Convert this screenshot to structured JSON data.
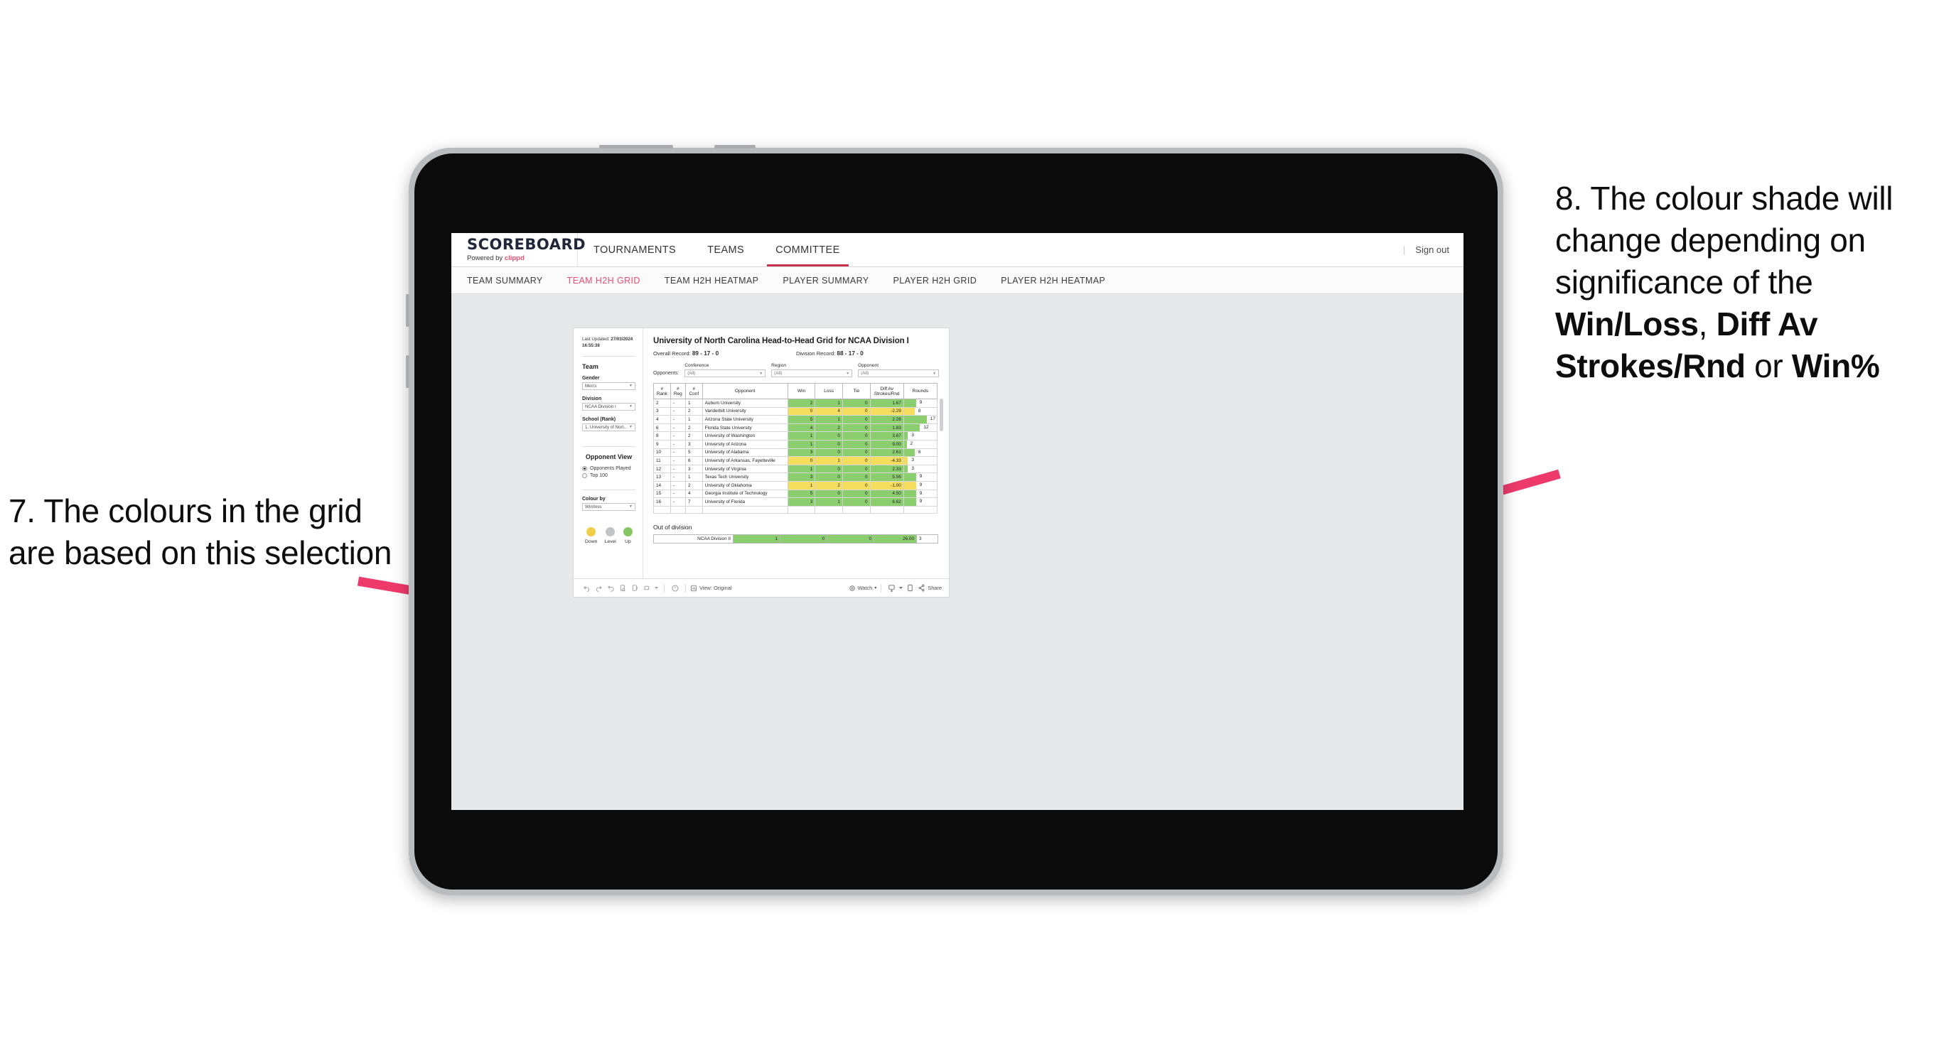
{
  "annotations": {
    "left": {
      "name": "annotation-7",
      "text": "7. The colours in the grid are based on this selection"
    },
    "right": {
      "name": "annotation-8",
      "prefix": "8. The colour shade will change depending on significance of the ",
      "bold1": "Win/Loss",
      "mid1": ", ",
      "bold2": "Diff Av Strokes/Rnd",
      "mid2": " or ",
      "bold3": "Win%"
    },
    "arrow_color": "#EE3A6B"
  },
  "app": {
    "logo": {
      "word": "SCOREBOARD",
      "powered_by": "Powered by ",
      "brand": "clippd"
    },
    "topnav": [
      {
        "label": "TOURNAMENTS",
        "active": false
      },
      {
        "label": "TEAMS",
        "active": false
      },
      {
        "label": "COMMITTEE",
        "active": true
      }
    ],
    "header_right": {
      "divider": "|",
      "sign_out": "Sign out"
    },
    "subnav": [
      {
        "label": "TEAM SUMMARY",
        "active": false
      },
      {
        "label": "TEAM H2H GRID",
        "active": true
      },
      {
        "label": "TEAM H2H HEATMAP",
        "active": false
      },
      {
        "label": "PLAYER SUMMARY",
        "active": false
      },
      {
        "label": "PLAYER H2H GRID",
        "active": false
      },
      {
        "label": "PLAYER H2H HEATMAP",
        "active": false
      }
    ],
    "accent_color": "#EF4C6F",
    "active_tab_underline": "#C8324F"
  },
  "sidebar": {
    "last_updated_label": "Last Updated: ",
    "last_updated_value": "27/03/2024 16:55:38",
    "team_heading": "Team",
    "fields": [
      {
        "label": "Gender",
        "value": "Men's"
      },
      {
        "label": "Division",
        "value": "NCAA Division I"
      },
      {
        "label": "School (Rank)",
        "value": "1. University of Nort..."
      }
    ],
    "opponent_view_heading": "Opponent View",
    "radios": [
      {
        "label": "Opponents Played",
        "selected": true
      },
      {
        "label": "Top 100",
        "selected": false
      }
    ],
    "colour_by": {
      "label": "Colour by",
      "value": "Win/loss"
    },
    "legend": [
      {
        "caption": "Down",
        "color": "#F2CE48"
      },
      {
        "caption": "Level",
        "color": "#C0C3C7"
      },
      {
        "caption": "Up",
        "color": "#86C763"
      }
    ]
  },
  "dashboard": {
    "title": "University of North Carolina Head-to-Head Grid for NCAA Division I",
    "overall_record_label": "Overall Record: ",
    "overall_record_value": "89 - 17 - 0",
    "division_record_label": "Division Record: ",
    "division_record_value": "88 - 17 - 0",
    "opponents_label": "Opponents:",
    "filters": [
      {
        "label": "Conference",
        "value": "(All)"
      },
      {
        "label": "Region",
        "value": "(All)"
      },
      {
        "label": "Opponent",
        "value": "(All)"
      }
    ],
    "out_of_division_title": "Out of division",
    "out_of_division_row": {
      "label": "NCAA Division II",
      "win": "1",
      "loss": "0",
      "tie": "0",
      "diff": "26.00",
      "rounds": "3"
    }
  },
  "chart_data": {
    "type": "table",
    "title": "University of North Carolina Head-to-Head Grid for NCAA Division I",
    "colour_by": "Win/loss",
    "colors": {
      "up": "#8BCE6E",
      "down": "#F5DD5E",
      "level": "#C0C3C7"
    },
    "columns": [
      "# Rank",
      "# Reg",
      "# Conf",
      "Opponent",
      "Win",
      "Loss",
      "Tie",
      "Diff Av Strokes/Rnd",
      "Rounds"
    ],
    "headers": [
      {
        "l1": "#",
        "l2": "Rank"
      },
      {
        "l1": "#",
        "l2": "Reg"
      },
      {
        "l1": "#",
        "l2": "Conf"
      },
      {
        "l1": "Opponent",
        "l2": ""
      },
      {
        "l1": "Win",
        "l2": ""
      },
      {
        "l1": "Loss",
        "l2": ""
      },
      {
        "l1": "Tie",
        "l2": ""
      },
      {
        "l1": "Diff Av",
        "l2": "Strokes/Rnd"
      },
      {
        "l1": "Rounds",
        "l2": ""
      }
    ],
    "rounds_max": 17,
    "rows": [
      {
        "rank": "2",
        "reg": "-",
        "conf": "1",
        "opponent": "Auburn University",
        "win": "2",
        "loss": "1",
        "tie": "0",
        "diff": "1.67",
        "rounds": "9",
        "state": "up"
      },
      {
        "rank": "3",
        "reg": "-",
        "conf": "2",
        "opponent": "Vanderbilt University",
        "win": "0",
        "loss": "4",
        "tie": "0",
        "diff": "-2.29",
        "rounds": "8",
        "state": "down"
      },
      {
        "rank": "4",
        "reg": "-",
        "conf": "1",
        "opponent": "Arizona State University",
        "win": "5",
        "loss": "1",
        "tie": "0",
        "diff": "2.28",
        "rounds": "17",
        "state": "up"
      },
      {
        "rank": "6",
        "reg": "-",
        "conf": "2",
        "opponent": "Florida State University",
        "win": "4",
        "loss": "2",
        "tie": "0",
        "diff": "1.83",
        "rounds": "12",
        "state": "up"
      },
      {
        "rank": "8",
        "reg": "-",
        "conf": "2",
        "opponent": "University of Washington",
        "win": "1",
        "loss": "0",
        "tie": "0",
        "diff": "3.67",
        "rounds": "3",
        "state": "up"
      },
      {
        "rank": "9",
        "reg": "-",
        "conf": "3",
        "opponent": "University of Arizona",
        "win": "1",
        "loss": "0",
        "tie": "0",
        "diff": "9.00",
        "rounds": "2",
        "state": "up"
      },
      {
        "rank": "10",
        "reg": "-",
        "conf": "5",
        "opponent": "University of Alabama",
        "win": "3",
        "loss": "0",
        "tie": "0",
        "diff": "2.61",
        "rounds": "8",
        "state": "up"
      },
      {
        "rank": "11",
        "reg": "-",
        "conf": "6",
        "opponent": "University of Arkansas, Fayetteville",
        "win": "0",
        "loss": "1",
        "tie": "0",
        "diff": "-4.33",
        "rounds": "3",
        "state": "down"
      },
      {
        "rank": "12",
        "reg": "-",
        "conf": "3",
        "opponent": "University of Virginia",
        "win": "1",
        "loss": "0",
        "tie": "0",
        "diff": "2.33",
        "rounds": "3",
        "state": "up"
      },
      {
        "rank": "13",
        "reg": "-",
        "conf": "1",
        "opponent": "Texas Tech University",
        "win": "3",
        "loss": "0",
        "tie": "0",
        "diff": "5.56",
        "rounds": "9",
        "state": "up"
      },
      {
        "rank": "14",
        "reg": "-",
        "conf": "2",
        "opponent": "University of Oklahoma",
        "win": "1",
        "loss": "2",
        "tie": "0",
        "diff": "-1.00",
        "rounds": "9",
        "state": "down"
      },
      {
        "rank": "15",
        "reg": "-",
        "conf": "4",
        "opponent": "Georgia Institute of Technology",
        "win": "5",
        "loss": "0",
        "tie": "0",
        "diff": "4.50",
        "rounds": "9",
        "state": "up"
      },
      {
        "rank": "16",
        "reg": "-",
        "conf": "7",
        "opponent": "University of Florida",
        "win": "3",
        "loss": "1",
        "tie": "0",
        "diff": "6.62",
        "rounds": "9",
        "state": "up"
      }
    ]
  },
  "toolbar": {
    "view_label": "View: Original",
    "watch_label": "Watch",
    "share_label": "Share",
    "caret": "▾"
  }
}
